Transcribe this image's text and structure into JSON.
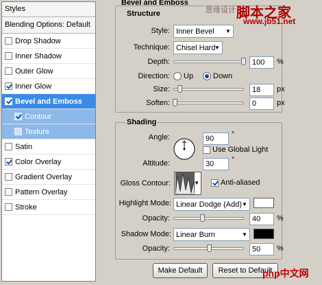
{
  "styles_panel": {
    "header": "Styles",
    "blending": "Blending Options: Default",
    "items": [
      {
        "label": "Drop Shadow",
        "checked": false,
        "state": "normal"
      },
      {
        "label": "Inner Shadow",
        "checked": false,
        "state": "normal"
      },
      {
        "label": "Outer Glow",
        "checked": false,
        "state": "normal"
      },
      {
        "label": "Inner Glow",
        "checked": true,
        "state": "normal"
      },
      {
        "label": "Bevel and Emboss",
        "checked": true,
        "state": "selected"
      },
      {
        "label": "Contour",
        "checked": true,
        "state": "sub"
      },
      {
        "label": "Texture",
        "checked": false,
        "state": "sub"
      },
      {
        "label": "Satin",
        "checked": false,
        "state": "normal"
      },
      {
        "label": "Color Overlay",
        "checked": true,
        "state": "normal"
      },
      {
        "label": "Gradient Overlay",
        "checked": false,
        "state": "normal"
      },
      {
        "label": "Pattern Overlay",
        "checked": false,
        "state": "normal"
      },
      {
        "label": "Stroke",
        "checked": false,
        "state": "normal"
      }
    ]
  },
  "bevel": {
    "title": "Bevel and Emboss",
    "structure_title": "Structure",
    "style_label": "Style:",
    "style_value": "Inner Bevel",
    "technique_label": "Technique:",
    "technique_value": "Chisel Hard",
    "depth_label": "Depth:",
    "depth_value": "100",
    "depth_unit": "%",
    "depth_level": 1.0,
    "direction_label": "Direction:",
    "dir_up": "Up",
    "dir_down": "Down",
    "size_label": "Size:",
    "size_value": "18",
    "size_unit": "px",
    "size_level": 0.07,
    "soften_label": "Soften:",
    "soften_value": "0",
    "soften_unit": "px",
    "soften_level": 0.0
  },
  "shading": {
    "title": "Shading",
    "angle_label": "Angle:",
    "angle_value": "90",
    "angle_unit": "°",
    "global_light_label": "Use Global Light",
    "altitude_label": "Altitude:",
    "altitude_value": "30",
    "altitude_unit": "°",
    "gloss_label": "Gloss Contour:",
    "anti_aliased_label": "Anti-aliased",
    "highlight_mode_label": "Highlight Mode:",
    "highlight_mode_value": "Linear Dodge (Add)",
    "highlight_color": "#ffffff",
    "opacity1_label": "Opacity:",
    "opacity1_value": "40",
    "opacity1_unit": "%",
    "opacity1_level": 0.4,
    "shadow_mode_label": "Shadow Mode:",
    "shadow_mode_value": "Linear Burn",
    "shadow_color": "#000000",
    "opacity2_label": "Opacity:",
    "opacity2_value": "50",
    "opacity2_unit": "%",
    "opacity2_level": 0.5
  },
  "buttons": {
    "make_default": "Make Default",
    "reset_default": "Reset to Default"
  },
  "watermark": {
    "top": "思缘设计",
    "brand": "脚本之家",
    "url": "www.jb51.net",
    "php": "php中文网"
  }
}
